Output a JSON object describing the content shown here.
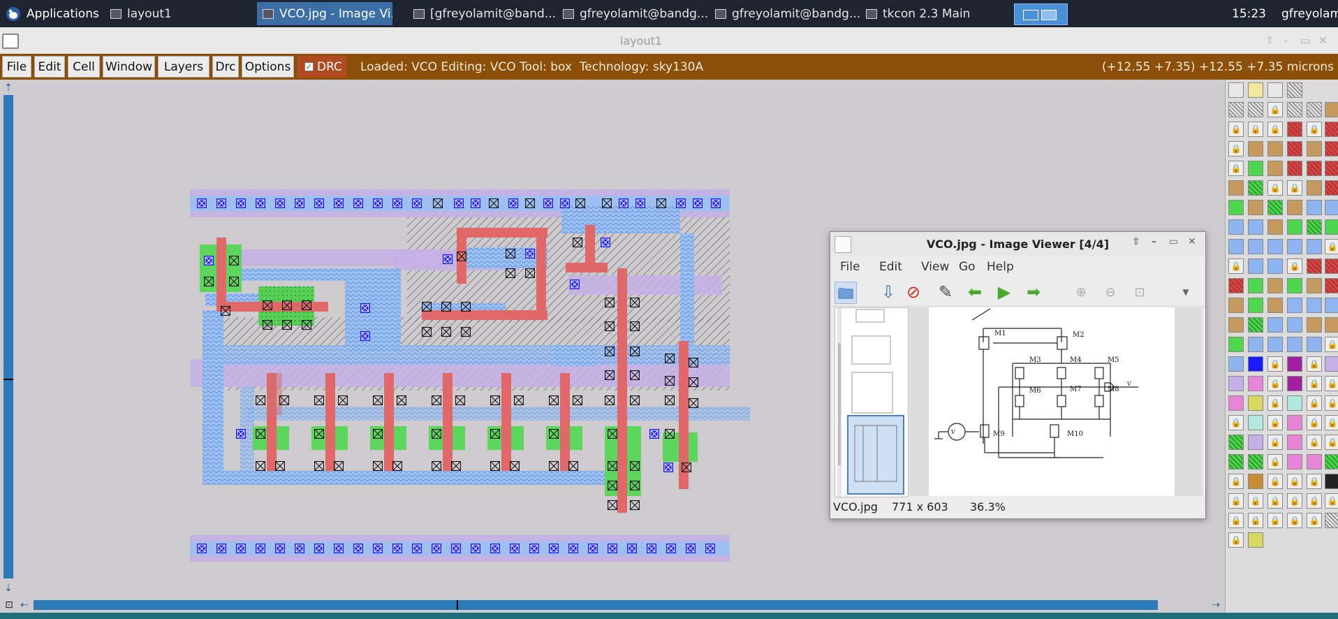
{
  "panel": {
    "applications_label": "Applications",
    "tasks": [
      {
        "label": "layout1"
      },
      {
        "label": "VCO.jpg - Image Vi..."
      },
      {
        "label": "[gfreyolamit@band..."
      },
      {
        "label": "gfreyolamit@bandg..."
      },
      {
        "label": "gfreyolamit@bandg..."
      },
      {
        "label": "tkcon 2.3 Main"
      }
    ],
    "clock": "15:23",
    "user": "gfreyolamit"
  },
  "window": {
    "title": "layout1"
  },
  "menu": {
    "items": [
      "File",
      "Edit",
      "Cell",
      "Window",
      "Layers",
      "Drc",
      "Options"
    ],
    "drc_label": "DRC",
    "status": "Loaded: VCO Editing: VCO Tool: box  Technology: sky130A",
    "coords": "(+12.55 +7.35) +12.55 +7.35 microns"
  },
  "viewer": {
    "title": "VCO.jpg - Image Viewer [4/4]",
    "menu": [
      "File",
      "Edit",
      "View",
      "Go",
      "Help"
    ],
    "filename": "VCO.jpg",
    "dimensions": "771 x 603",
    "zoom": "36.3%",
    "schematic_labels": [
      "M1",
      "M2",
      "M3",
      "M4",
      "M5",
      "M6",
      "M7",
      "M8",
      "M9",
      "M10",
      "V",
      "V"
    ]
  },
  "colors": {
    "panel_bg": "#1e2430",
    "menubar_bg": "#8b4f0a",
    "canvas_bg": "#cdcbcd",
    "metal1": "#b9a3e0",
    "poly": "#e06868",
    "diffusion": "#5cd65c",
    "locali": "#8fb4f2",
    "contact": "#1a1aff",
    "scrollbar": "#2c7ab8"
  }
}
